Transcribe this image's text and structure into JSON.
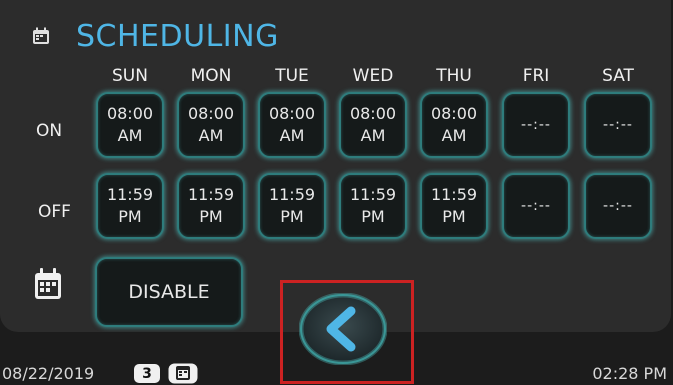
{
  "header": {
    "title": "SCHEDULING",
    "icon": "calendar-icon"
  },
  "days": [
    "SUN",
    "MON",
    "TUE",
    "WED",
    "THU",
    "FRI",
    "SAT"
  ],
  "rows": {
    "on": {
      "label": "ON",
      "times": [
        {
          "time": "08:00",
          "period": "AM"
        },
        {
          "time": "08:00",
          "period": "AM"
        },
        {
          "time": "08:00",
          "period": "AM"
        },
        {
          "time": "08:00",
          "period": "AM"
        },
        {
          "time": "08:00",
          "period": "AM"
        },
        {
          "time": "--:--",
          "period": ""
        },
        {
          "time": "--:--",
          "period": ""
        }
      ]
    },
    "off": {
      "label": "OFF",
      "times": [
        {
          "time": "11:59",
          "period": "PM"
        },
        {
          "time": "11:59",
          "period": "PM"
        },
        {
          "time": "11:59",
          "period": "PM"
        },
        {
          "time": "11:59",
          "period": "PM"
        },
        {
          "time": "11:59",
          "period": "PM"
        },
        {
          "time": "--:--",
          "period": ""
        },
        {
          "time": "--:--",
          "period": ""
        }
      ]
    }
  },
  "controls": {
    "disable_label": "DISABLE",
    "back_icon": "chevron-left-icon",
    "calendar_icon": "calendar-icon"
  },
  "status_bar": {
    "date": "08/22/2019",
    "badge": "3",
    "time": "02:28 PM",
    "schedule_icon": "calendar-icon"
  },
  "colors": {
    "accent": "#4fb6e6",
    "cell_border": "#2e7c7c",
    "highlight": "#cc2222"
  }
}
